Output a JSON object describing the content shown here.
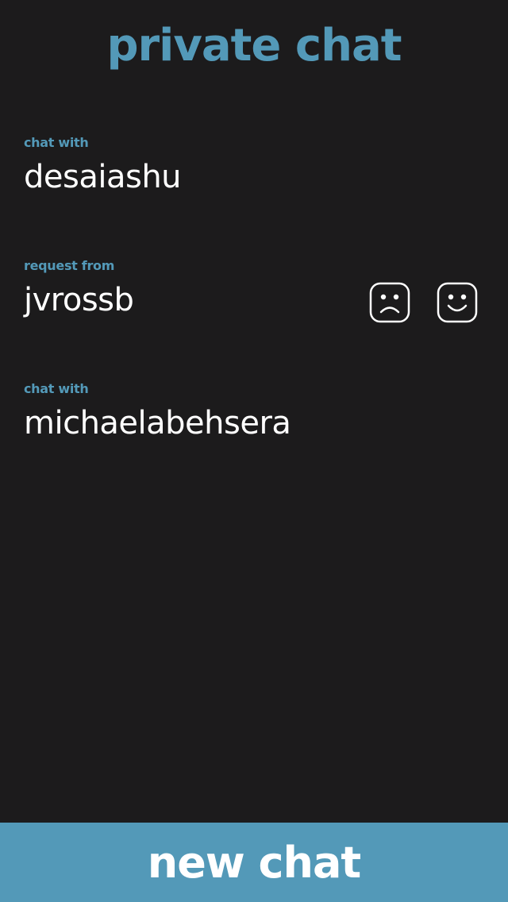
{
  "header": {
    "title": "private chat"
  },
  "colors": {
    "accent": "#5399b8",
    "background": "#1c1b1c",
    "text": "#ffffff"
  },
  "chats": [
    {
      "label": "chat with",
      "name": "desaiashu"
    },
    {
      "label": "request from",
      "name": "jvrossb",
      "actions": {
        "decline_icon": "frown-face-icon",
        "accept_icon": "smile-face-icon"
      }
    },
    {
      "label": "chat with",
      "name": "michaelabehsera"
    }
  ],
  "footer": {
    "new_chat_label": "new chat"
  }
}
